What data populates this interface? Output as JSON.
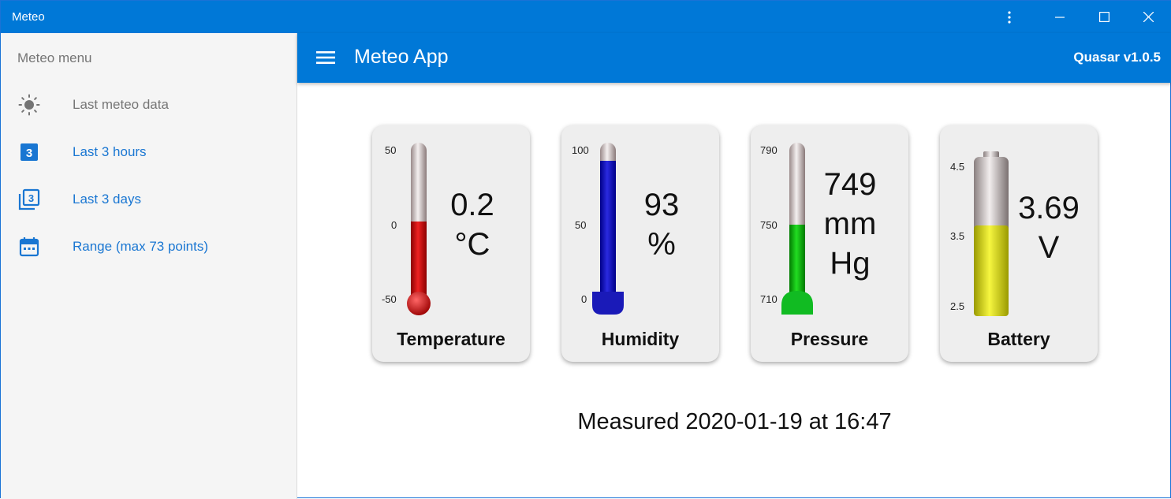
{
  "window": {
    "title": "Meteo"
  },
  "header": {
    "app_title": "Meteo App",
    "version": "Quasar v1.0.5"
  },
  "sidebar": {
    "title": "Meteo menu",
    "items": [
      {
        "label": "Last meteo data",
        "icon": "sun-icon",
        "color": "#757575"
      },
      {
        "label": "Last 3 hours",
        "icon": "filter-3-icon",
        "color": "#1976d2"
      },
      {
        "label": "Last 3 days",
        "icon": "filter-3-stack-icon",
        "color": "#1976d2"
      },
      {
        "label": "Range (max 73 points)",
        "icon": "calendar-icon",
        "color": "#1976d2"
      }
    ]
  },
  "gauges": {
    "temperature": {
      "name": "Temperature",
      "value": "0.2",
      "unit": "°C",
      "ticks": [
        "50",
        "0",
        "-50"
      ],
      "fill_fraction": 0.502,
      "color": "#dd1111"
    },
    "humidity": {
      "name": "Humidity",
      "value": "93",
      "unit": "%",
      "ticks": [
        "100",
        "50",
        "0"
      ],
      "fill_fraction": 0.93,
      "color": "#1a1acc"
    },
    "pressure": {
      "name": "Pressure",
      "value": "749",
      "unit_line1": "mm",
      "unit_line2": "Hg",
      "ticks": [
        "790",
        "750",
        "710"
      ],
      "fill_fraction": 0.4875,
      "color": "#11bb22"
    },
    "battery": {
      "name": "Battery",
      "value": "3.69",
      "unit": "V",
      "ticks": [
        "4.5",
        "3.5",
        "2.5"
      ],
      "fill_fraction": 0.595,
      "color": "#e8e820"
    }
  },
  "measured": "Measured 2020-01-19 at 16:47"
}
